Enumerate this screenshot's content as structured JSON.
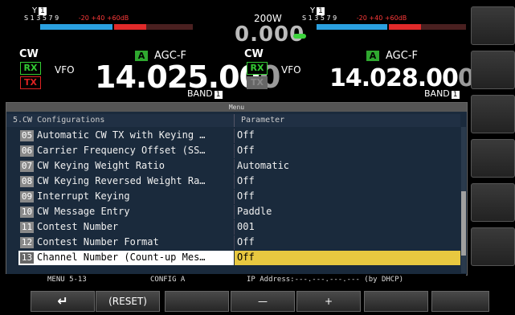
{
  "left": {
    "antenna": "1",
    "smeter_scale": {
      "s": "S 1  3  5  7  9",
      "red": "-20  +40 +60dB"
    },
    "mode": "CW",
    "rx": "RX",
    "tx": "TX",
    "vfo": "VFO",
    "agc_badge": "A",
    "agc": "AGC-F",
    "freq_main": "14.025.00",
    "freq_last": "0",
    "band_label": "BAND",
    "band_num": "1"
  },
  "center": {
    "power": "200W",
    "power_value": "0.000"
  },
  "right": {
    "antenna": "1",
    "smeter_scale": {
      "s": "S 1  3  5  7  9",
      "red": "-20  +40 +60dB"
    },
    "mode": "CW",
    "rx": "RX",
    "tx": "TX",
    "vfo": "VFO",
    "agc_badge": "A",
    "agc": "AGC-F",
    "freq_main": "14.028.00",
    "freq_last": "0",
    "band_label": "BAND",
    "band_num": "1"
  },
  "menu": {
    "title": "Menu",
    "section": "5.CW Configurations",
    "param_header": "Parameter",
    "rows": [
      {
        "num": "05",
        "name": "Automatic CW TX with Keying …",
        "param": "Off"
      },
      {
        "num": "06",
        "name": "Carrier Frequency Offset (SS…",
        "param": "Off"
      },
      {
        "num": "07",
        "name": "CW Keying Weight Ratio",
        "param": "Automatic"
      },
      {
        "num": "08",
        "name": "CW Keying Reversed Weight Ra…",
        "param": "Off"
      },
      {
        "num": "09",
        "name": "Interrupt Keying",
        "param": "Off"
      },
      {
        "num": "10",
        "name": "CW Message Entry",
        "param": "Paddle"
      },
      {
        "num": "11",
        "name": "Contest Number",
        "param": "001"
      },
      {
        "num": "12",
        "name": "Contest Number Format",
        "param": "Off"
      },
      {
        "num": "13",
        "name": "Channel Number (Count-up Mes…",
        "param": "Off"
      }
    ]
  },
  "status": {
    "menu_pos": "MENU 5-13",
    "config": "CONFIG A",
    "ip": "IP Address:---.---.---.--- (by DHCP)"
  },
  "fkeys": {
    "back": "↵",
    "reset": "(RESET)",
    "minus": "—",
    "plus": "+"
  },
  "colors": {
    "rx": "#3c3",
    "tx": "#d22",
    "selected_param": "#e8c840",
    "meter_blue": "#2aa0e0",
    "meter_red": "#e02a2a"
  }
}
